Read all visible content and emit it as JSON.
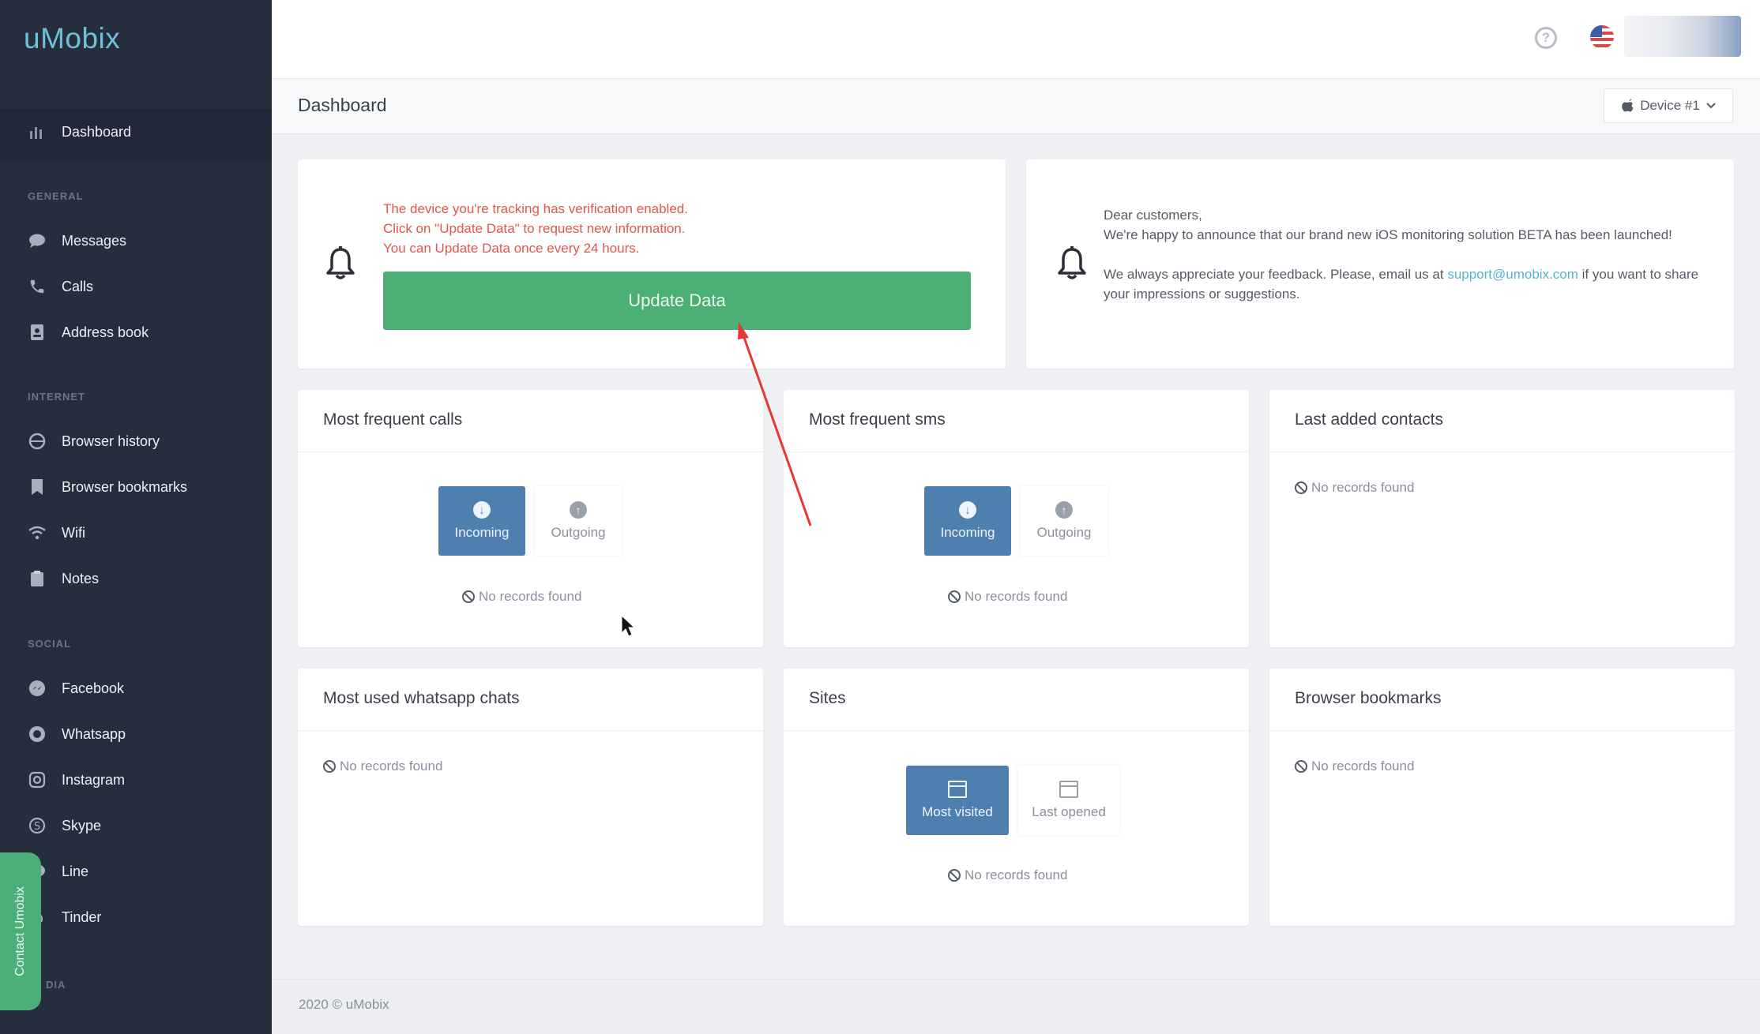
{
  "app": {
    "logo": "uMobix"
  },
  "sidebar": {
    "dashboard": "Dashboard",
    "sections": {
      "general": "GENERAL",
      "internet": "INTERNET",
      "social": "SOCIAL",
      "media": "DIA"
    },
    "general": [
      "Messages",
      "Calls",
      "Address book"
    ],
    "internet": [
      "Browser history",
      "Browser bookmarks",
      "Wifi",
      "Notes"
    ],
    "social": [
      "Facebook",
      "Whatsapp",
      "Instagram",
      "Skype",
      "Line",
      "Tinder"
    ],
    "contact_tab": "Contact Umobix"
  },
  "topbar": {
    "help": "?"
  },
  "header": {
    "title": "Dashboard",
    "device": "Device #1"
  },
  "alert": {
    "line1": "The device you're tracking has verification enabled.",
    "line2": "Click on \"Update Data\" to request new information.",
    "line3": "You can Update Data once every 24 hours.",
    "button": "Update Data"
  },
  "news": {
    "greeting": "Dear customers,",
    "announcement": "We're happy to announce that our brand new iOS monitoring solution BETA has been launched!",
    "feedback_pre": "We always appreciate your feedback. Please, email us at",
    "email": "support@umobix.com",
    "feedback_post": "if you want to share your impressions or suggestions."
  },
  "cards": {
    "calls": {
      "title": "Most frequent calls",
      "incoming": "Incoming",
      "outgoing": "Outgoing",
      "empty": "No records found"
    },
    "sms": {
      "title": "Most frequent sms",
      "incoming": "Incoming",
      "outgoing": "Outgoing",
      "empty": "No records found"
    },
    "contacts": {
      "title": "Last added contacts",
      "empty": "No records found"
    },
    "whatsapp": {
      "title": "Most used whatsapp chats",
      "empty": "No records found"
    },
    "sites": {
      "title": "Sites",
      "most_visited": "Most visited",
      "last_opened": "Last opened",
      "empty": "No records found"
    },
    "bookmarks": {
      "title": "Browser bookmarks",
      "empty": "No records found"
    }
  },
  "footer": {
    "text": "2020 © uMobix"
  },
  "colors": {
    "sidebar": "#262d3d",
    "accent_green": "#4caf75",
    "accent_blue": "#4f7fae",
    "alert_red": "#e0574f",
    "arrow": "#e53935"
  }
}
